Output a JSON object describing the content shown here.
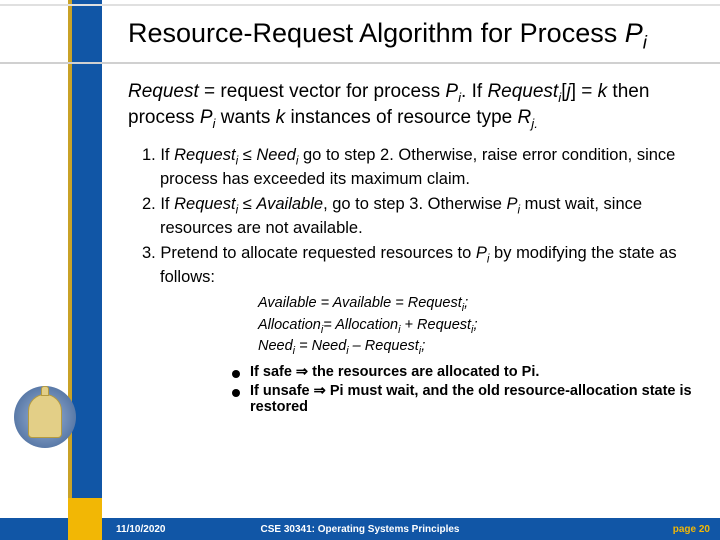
{
  "title": {
    "pre": "Resource-Request Algorithm for Process ",
    "var": "P",
    "sub": "i"
  },
  "intro": {
    "r": "Request",
    "t1": " = request vector for process ",
    "pvar": "P",
    "psub": "i",
    "t2": ".  If ",
    "rvar": "Request",
    "rsub": "i",
    "t3": "[",
    "jvar": "j",
    "t4": "] = ",
    "kvar": "k",
    "t5": " then process ",
    "pvar2": "P",
    "psub2": "i",
    "t6": " wants ",
    "kvar2": "k",
    "t7": " instances of resource type ",
    "rjvar": "R",
    "rjsub": "j.",
    "tail": ""
  },
  "steps": {
    "s1": {
      "num": "1. If ",
      "a": "Request",
      "asub": "i",
      "op": " ≤ ",
      "b": "Need",
      "bsub": "i",
      "mid": " go to step 2.  Otherwise, raise error condition, since process has exceeded its maximum claim."
    },
    "s2": {
      "num": "2. If ",
      "a": "Request",
      "asub": "i",
      "op": " ≤ ",
      "b": "Available",
      "mid": ", go to step 3.  Otherwise ",
      "p": "P",
      "psub": "i",
      "tail": " must wait, since resources are not available."
    },
    "s3": {
      "num": "3. Pretend to allocate requested resources to ",
      "p": "P",
      "psub": "i",
      "tail": " by modifying the state as follows:"
    }
  },
  "formulas": {
    "f1": {
      "lhs": "Available",
      "eq1": " = ",
      "mid": "Available",
      "eq2": " = ",
      "rhs": "Request",
      "rsub": "i",
      "end": ";"
    },
    "f2": {
      "lhs": "Allocation",
      "lsub": "i",
      "eq": "= ",
      "mid": "Allocation",
      "msub": "i",
      "op": " + ",
      "rhs": "Request",
      "rsub": "i",
      "end": ";"
    },
    "f3": {
      "lhs": "Need",
      "lsub": "i",
      "eq": " = ",
      "mid": "Need",
      "msub": "i",
      "op": " – ",
      "rhs": "Request",
      "rsub": "i",
      "end": ";"
    }
  },
  "bullets": {
    "b1": "If safe ⇒ the resources are allocated to Pi.",
    "b2": "If unsafe ⇒ Pi must wait, and the old resource-allocation state is restored"
  },
  "footer": {
    "date": "11/10/2020",
    "course": "CSE 30341: Operating Systems Principles",
    "page": "page 20"
  }
}
